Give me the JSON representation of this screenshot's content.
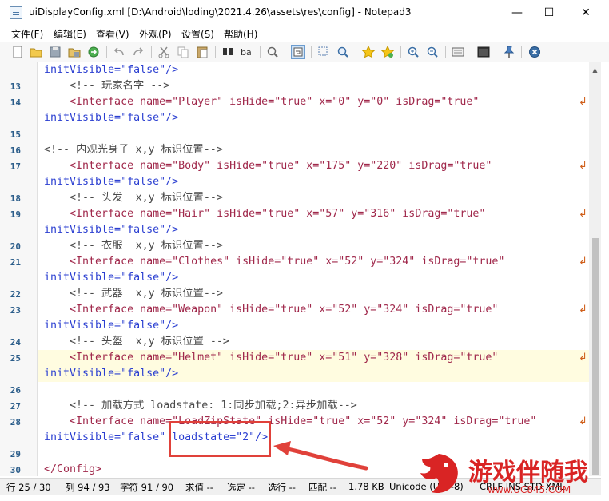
{
  "window": {
    "title": "uiDisplayConfig.xml [D:\\Android\\loding\\2021.4.26\\assets\\res\\config] - Notepad3",
    "minimize_glyph": "—",
    "maximize_glyph": "☐",
    "close_glyph": "✕"
  },
  "menu": [
    "文件(F)",
    "编辑(E)",
    "查看(V)",
    "外观(P)",
    "设置(S)",
    "帮助(H)"
  ],
  "toolbar_icons": [
    "new-file-icon",
    "open-folder-icon",
    "save-icon",
    "save-as-icon",
    "reload-icon",
    "undo-icon",
    "redo-icon",
    "cut-icon",
    "copy-icon",
    "paste-icon",
    "find-icon",
    "replace-icon",
    "find-in-files-icon",
    "word-wrap-icon",
    "select-icon",
    "zoom-icon",
    "bookmark-icon",
    "bookmark-all-icon",
    "zoom-in-icon",
    "zoom-out-icon",
    "view-icon",
    "terminal-icon",
    "pin-icon",
    "close-doc-icon"
  ],
  "editor": {
    "line_numbers": [
      "13",
      "14",
      "",
      "15",
      "16",
      "17",
      "",
      "18",
      "19",
      "",
      "20",
      "21",
      "",
      "22",
      "23",
      "",
      "24",
      "25",
      "",
      "26",
      "27",
      "28",
      "",
      "29",
      "30"
    ],
    "lines": [
      {
        "text": "initVisible=\"false\"/>"
      },
      {
        "text": "    <!-- 玩家名字 -->"
      },
      {
        "text": "    <Interface name=\"Player\" isHide=\"true\" x=\"0\" y=\"0\" isDrag=\"true\""
      },
      {
        "text": "initVisible=\"false\"/>"
      },
      {
        "text": ""
      },
      {
        "text": "<!-- 内观光身子 x,y 标识位置-->"
      },
      {
        "text": "    <Interface name=\"Body\" isHide=\"true\" x=\"175\" y=\"220\" isDrag=\"true\""
      },
      {
        "text": "initVisible=\"false\"/>"
      },
      {
        "text": "    <!-- 头发  x,y 标识位置-->"
      },
      {
        "text": "    <Interface name=\"Hair\" isHide=\"true\" x=\"57\" y=\"316\" isDrag=\"true\""
      },
      {
        "text": "initVisible=\"false\"/>"
      },
      {
        "text": "    <!-- 衣服  x,y 标识位置-->"
      },
      {
        "text": "    <Interface name=\"Clothes\" isHide=\"true\" x=\"52\" y=\"324\" isDrag=\"true\""
      },
      {
        "text": "initVisible=\"false\"/>"
      },
      {
        "text": "    <!-- 武器  x,y 标识位置-->"
      },
      {
        "text": "    <Interface name=\"Weapon\" isHide=\"true\" x=\"52\" y=\"324\" isDrag=\"true\""
      },
      {
        "text": "initVisible=\"false\"/>"
      },
      {
        "text": "    <!-- 头盔  x,y 标识位置 -->"
      },
      {
        "text": "    <Interface name=\"Helmet\" isHide=\"true\" x=\"51\" y=\"328\" isDrag=\"true\""
      },
      {
        "text": "initVisible=\"false\"/>"
      },
      {
        "text": ""
      },
      {
        "text": "    <!-- 加载方式 loadstate: 1:同步加载;2:异步加载-->"
      },
      {
        "text": "    <Interface name=\"LoadZipState\" isHide=\"true\" x=\"52\" y=\"324\" isDrag=\"true\""
      },
      {
        "text": "initVisible=\"false\" loadstate=\"2\"/>"
      },
      {
        "text": ""
      },
      {
        "text": "</Config>"
      }
    ],
    "wrap_mark": "↲"
  },
  "status": {
    "line": "行 25 / 30",
    "column": "列 94 / 93",
    "chars": "字符 91 / 90",
    "value": "求值 --",
    "selection": "选定 --",
    "lines_sel": "选行 --",
    "match": "匹配 --",
    "size": "1.78 KB",
    "encoding": "Unicode (UTF-8)",
    "tail": "CRLF INS STD XML"
  },
  "watermark": {
    "text": "游戏伴随我",
    "sub": "www.UC845.COM"
  },
  "colors": {
    "highlight": "#fffce0",
    "annotation_red": "#e0413a",
    "tag": "#a0284b",
    "attr": "#6a3fa5",
    "value": "#2b3fd1"
  }
}
